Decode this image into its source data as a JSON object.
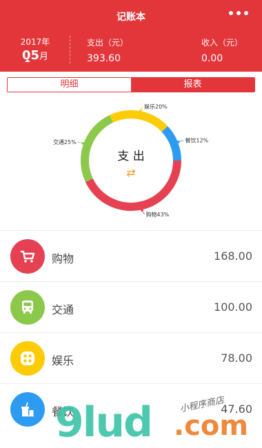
{
  "header": {
    "title": "记账本",
    "year": "2017年",
    "month": "05",
    "month_unit": "月",
    "expense_label": "支出（元）",
    "expense_value": "393.60",
    "income_label": "收入（元）",
    "income_value": "0.00"
  },
  "tabs": [
    {
      "label": "明细",
      "active": false
    },
    {
      "label": "报表",
      "active": true
    }
  ],
  "chart": {
    "center_label": "支 出",
    "swap_symbol": "⇄"
  },
  "chart_data": {
    "type": "pie",
    "title": "",
    "categories": [
      "购物",
      "交通",
      "娱乐",
      "餐饮"
    ],
    "values": [
      43,
      25,
      20,
      12
    ],
    "labels": [
      "购物43%",
      "交通25%",
      "娱乐20%",
      "餐饮12%"
    ],
    "colors": [
      "#e64152",
      "#8cc84b",
      "#fdcc07",
      "#2d9bf0"
    ]
  },
  "categories": [
    {
      "name": "购物",
      "amount": "168.00",
      "color": "#e64152",
      "icon": "cart-icon"
    },
    {
      "name": "交通",
      "amount": "100.00",
      "color": "#8cc84b",
      "icon": "bus-icon"
    },
    {
      "name": "娱乐",
      "amount": "78.00",
      "color": "#fdcc07",
      "icon": "entertainment-icon"
    },
    {
      "name": "餐饮",
      "amount": "47.60",
      "color": "#2d9bf0",
      "icon": "food-icon"
    }
  ],
  "watermark": {
    "main": "9lud",
    "suffix": ".com",
    "tagline": "小程序商店"
  }
}
